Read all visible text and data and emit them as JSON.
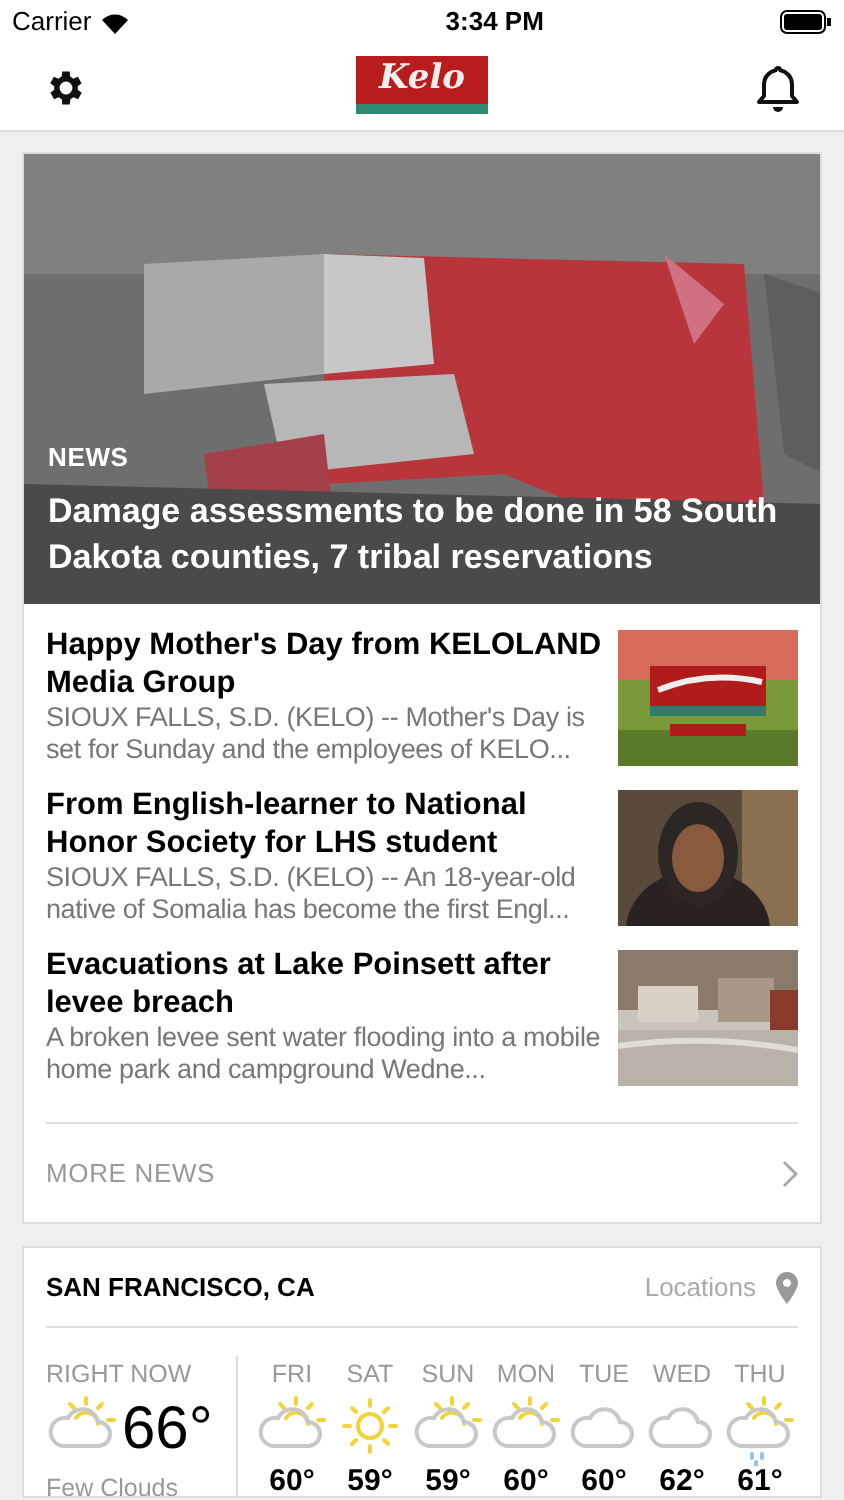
{
  "status_bar": {
    "carrier": "Carrier",
    "time": "3:34 PM"
  },
  "nav": {
    "logo_text": "Kelo"
  },
  "hero": {
    "category": "NEWS",
    "headline": "Damage assessments to be done in 58 South Dakota counties, 7 tribal reservations"
  },
  "stories": [
    {
      "headline": "Happy Mother's Day from KELOLAND Media Group",
      "summary": "SIOUX FALLS, S.D. (KELO) -- Mother's Day is set for Sunday and the employees of KELO..."
    },
    {
      "headline": "From English-learner to National Honor Society for LHS student",
      "summary": "SIOUX FALLS, S.D. (KELO) -- An 18-year-old native of Somalia has become the first Engl..."
    },
    {
      "headline": "Evacuations at Lake Poinsett after levee breach",
      "summary": "A broken levee sent water flooding into a mobile home park and campground Wedne..."
    }
  ],
  "more_news": "MORE NEWS",
  "weather": {
    "location": "SAN FRANCISCO, CA",
    "locations_link": "Locations",
    "now": {
      "label": "RIGHT NOW",
      "kind": "partly_cloudy",
      "temp": "66°",
      "condition": "Few Clouds"
    },
    "days": [
      {
        "day": "FRI",
        "kind": "partly_cloudy",
        "temp": "60°"
      },
      {
        "day": "SAT",
        "kind": "sunny",
        "temp": "59°"
      },
      {
        "day": "SUN",
        "kind": "partly_cloudy",
        "temp": "59°"
      },
      {
        "day": "MON",
        "kind": "partly_cloudy",
        "temp": "60°"
      },
      {
        "day": "TUE",
        "kind": "cloudy",
        "temp": "60°"
      },
      {
        "day": "WED",
        "kind": "cloudy",
        "temp": "62°"
      },
      {
        "day": "THU",
        "kind": "rain",
        "temp": "61°"
      }
    ]
  }
}
